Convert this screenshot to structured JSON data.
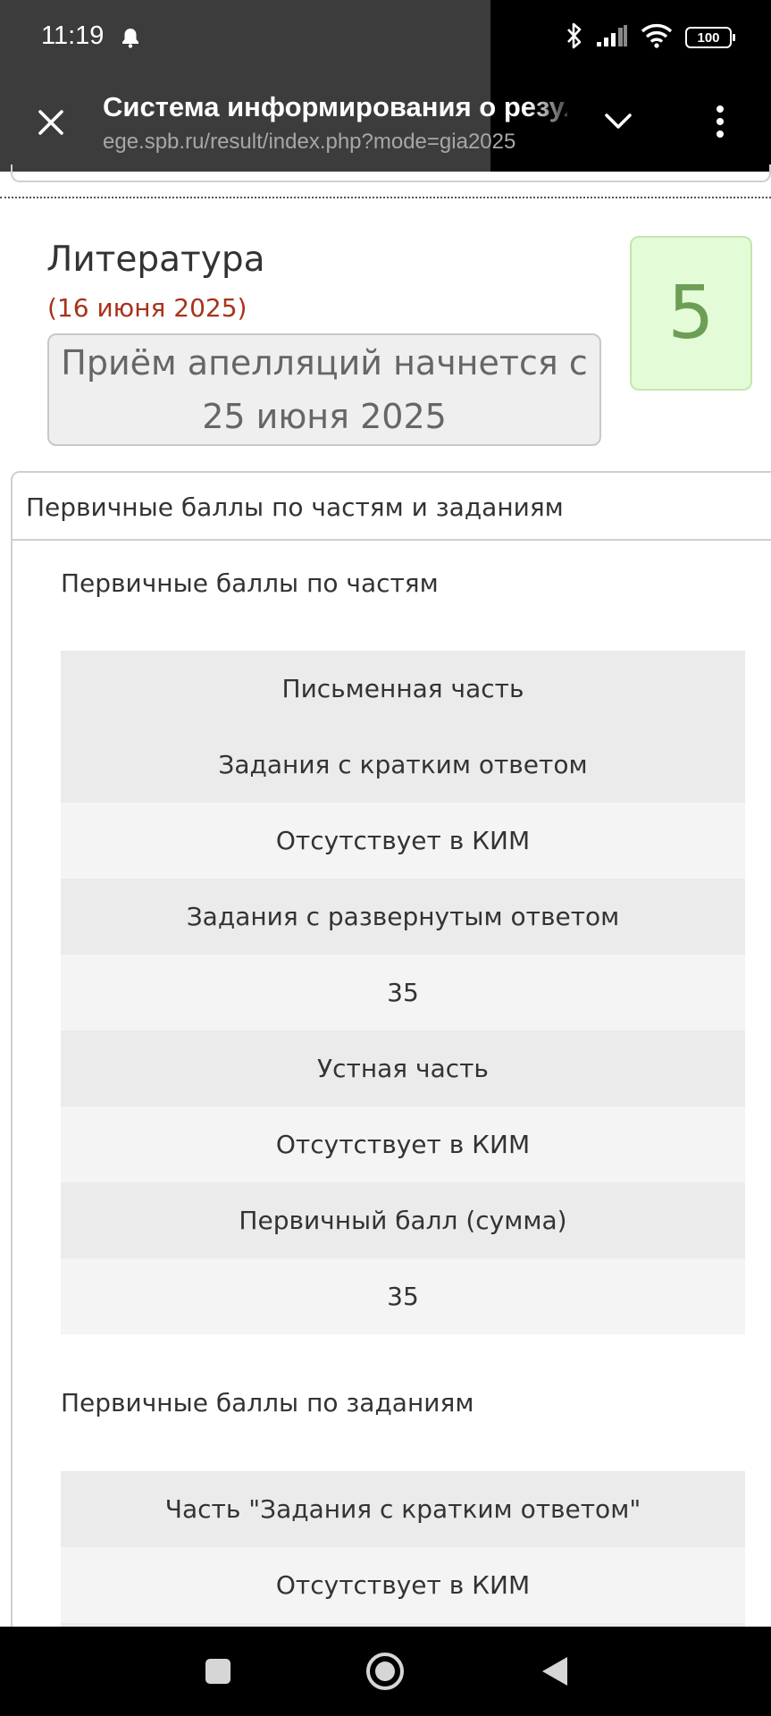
{
  "status_bar": {
    "time": "11:19",
    "battery": "100",
    "icons": [
      "bell-icon",
      "bluetooth-icon",
      "signal-icon",
      "wifi-icon",
      "battery-icon"
    ]
  },
  "toolbar": {
    "title": "Система информирования о результатах",
    "url": "ege.spb.ru/result/index.php?mode=gia2025",
    "icons": [
      "close-icon",
      "chevron-down-icon",
      "more-vert-icon"
    ]
  },
  "result": {
    "subject": "Литература",
    "date": "(16 июня 2025)",
    "appeal_notice": "Приём апелляций начнется с 25 июня 2025",
    "grade": "5",
    "grade_color": "#6e9e56",
    "date_color": "#a8321a"
  },
  "accordion": {
    "header": "Первичные баллы по частям и заданиям",
    "parts_title": "Первичные баллы по частям",
    "parts_table": [
      {
        "kind": "h",
        "text": "Письменная часть"
      },
      {
        "kind": "h",
        "text": "Задания с кратким ответом"
      },
      {
        "kind": "v",
        "text": "Отсутствует в КИМ"
      },
      {
        "kind": "h",
        "text": "Задания с развернутым ответом"
      },
      {
        "kind": "v",
        "text": "35"
      },
      {
        "kind": "h",
        "text": "Устная часть"
      },
      {
        "kind": "v",
        "text": "Отсутствует в КИМ"
      },
      {
        "kind": "h",
        "text": "Первичный балл (сумма)"
      },
      {
        "kind": "v",
        "text": "35"
      }
    ],
    "tasks_title": "Первичные баллы по заданиям",
    "tasks_table": [
      {
        "kind": "h",
        "text": "Часть \"Задания с кратким ответом\""
      },
      {
        "kind": "v",
        "text": "Отсутствует в КИМ"
      },
      {
        "kind": "h",
        "text": ""
      }
    ]
  },
  "nav_bar": {
    "icons": [
      "recents-icon",
      "home-icon",
      "back-icon"
    ]
  }
}
